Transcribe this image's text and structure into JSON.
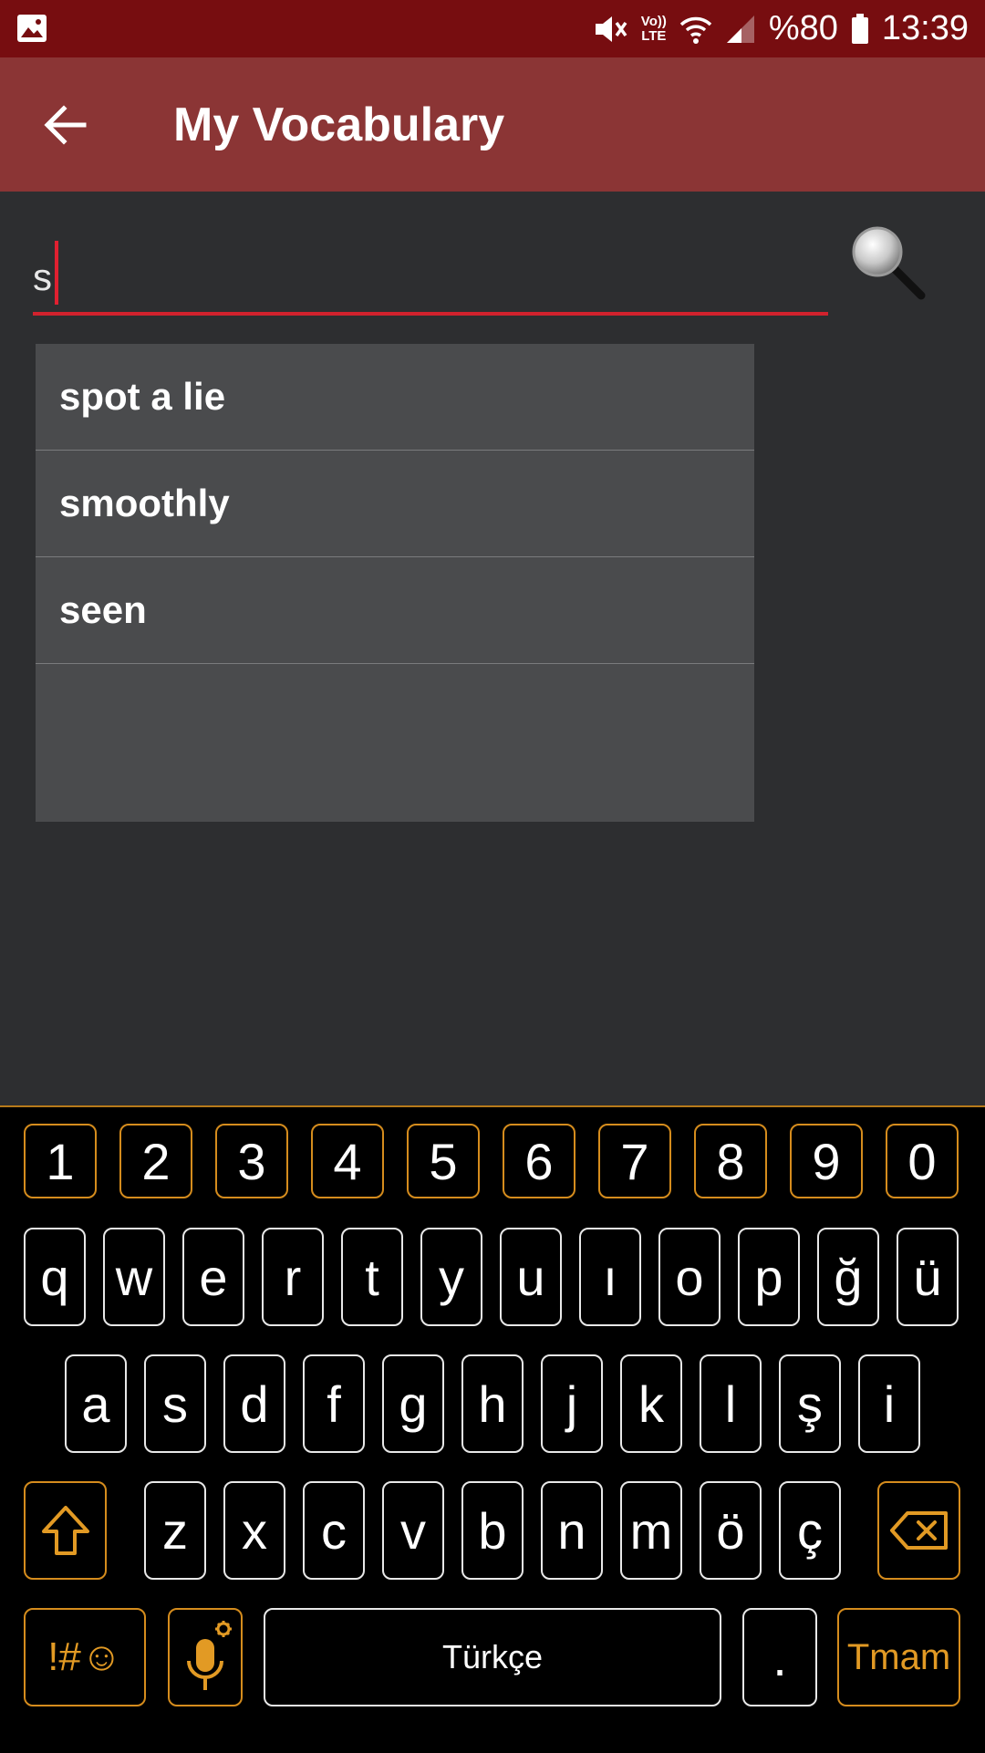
{
  "status_bar": {
    "battery_text": "%80",
    "time": "13:39",
    "network_label_top": "Vo))",
    "network_label_bottom": "LTE"
  },
  "app_bar": {
    "title": "My Vocabulary"
  },
  "search": {
    "value": "s"
  },
  "suggestions": [
    "spot a lie",
    "smoothly",
    "seen"
  ],
  "keyboard": {
    "numbers": [
      "1",
      "2",
      "3",
      "4",
      "5",
      "6",
      "7",
      "8",
      "9",
      "0"
    ],
    "row1": [
      "q",
      "w",
      "e",
      "r",
      "t",
      "y",
      "u",
      "ı",
      "o",
      "p",
      "ğ",
      "ü"
    ],
    "row2": [
      "a",
      "s",
      "d",
      "f",
      "g",
      "h",
      "j",
      "k",
      "l",
      "ş",
      "i"
    ],
    "row3": [
      "z",
      "x",
      "c",
      "v",
      "b",
      "n",
      "m",
      "ö",
      "ç"
    ],
    "symbols_label": "!#☺",
    "space_label": "Türkçe",
    "period_label": ".",
    "done_label": "Tmam"
  },
  "colors": {
    "status_bar": "#770d10",
    "app_bar": "#8b3535",
    "background": "#2d2e30",
    "suggestion_bg": "#4a4b4d",
    "accent_red": "#d1222d",
    "keyboard_orange": "#d58c1d"
  }
}
